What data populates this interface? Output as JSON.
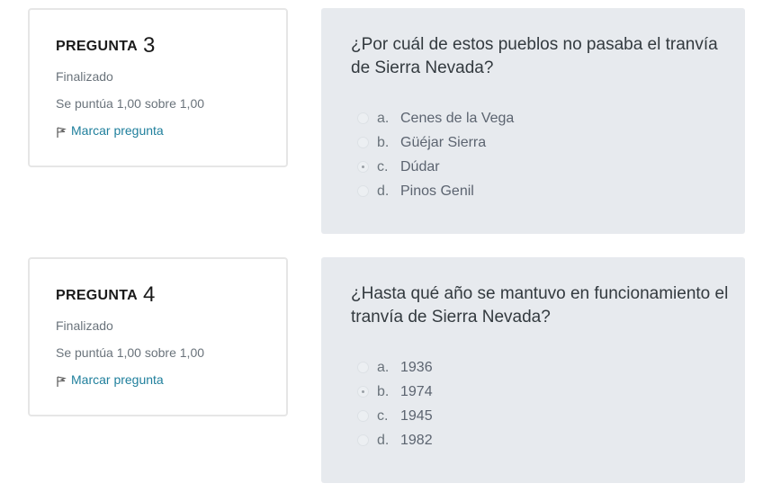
{
  "questions": [
    {
      "label": "PREGUNTA",
      "number": "3",
      "state": "Finalizado",
      "grade": "Se puntúa 1,00 sobre 1,00",
      "flag_label": "Marcar pregunta",
      "text": "¿Por cuál de estos pueblos no pasaba el tranvía de Sierra Nevada?",
      "answers": [
        {
          "letter": "a.",
          "text": "Cenes de la Vega",
          "selected": false
        },
        {
          "letter": "b.",
          "text": "Güéjar Sierra",
          "selected": false
        },
        {
          "letter": "c.",
          "text": "Dúdar",
          "selected": true
        },
        {
          "letter": "d.",
          "text": "Pinos Genil",
          "selected": false
        }
      ]
    },
    {
      "label": "PREGUNTA",
      "number": "4",
      "state": "Finalizado",
      "grade": "Se puntúa 1,00 sobre 1,00",
      "flag_label": "Marcar pregunta",
      "text": "¿Hasta qué año se mantuvo en funcionamiento el tranvía de Sierra Nevada?",
      "answers": [
        {
          "letter": "a.",
          "text": "1936",
          "selected": false
        },
        {
          "letter": "b.",
          "text": "1974",
          "selected": true
        },
        {
          "letter": "c.",
          "text": "1945",
          "selected": false
        },
        {
          "letter": "d.",
          "text": "1982",
          "selected": false
        }
      ]
    }
  ],
  "icons": {
    "flag": "flag-icon"
  },
  "colors": {
    "link": "#1f7f9c",
    "content_bg": "#e7eaee",
    "border": "#e6e6e6"
  }
}
